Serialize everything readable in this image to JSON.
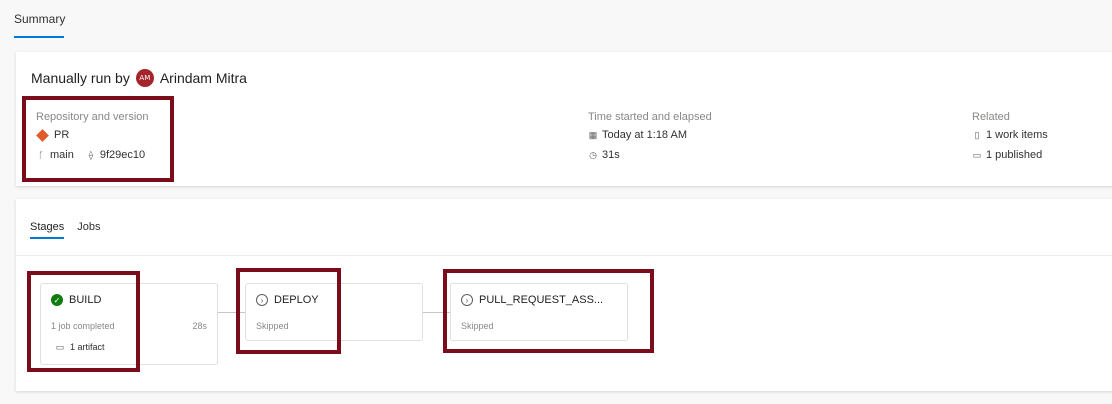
{
  "summary_tab": "Summary",
  "run": {
    "run_by_label": "Manually run by",
    "avatar_initials": "AM",
    "user_name": "Arindam Mitra"
  },
  "repository": {
    "label": "Repository and version",
    "repo_name": "PR",
    "branch": "main",
    "commit": "9f29ec10"
  },
  "time": {
    "label": "Time started and elapsed",
    "started": "Today at 1:18 AM",
    "elapsed": "31s"
  },
  "related": {
    "label": "Related",
    "work_items": "1 work items",
    "published": "1 published"
  },
  "stage_tabs": [
    "Stages",
    "Jobs"
  ],
  "stages": [
    {
      "name": "BUILD",
      "status": "1 job completed",
      "duration": "28s",
      "artifact": "1 artifact"
    },
    {
      "name": "DEPLOY",
      "status": "Skipped"
    },
    {
      "name": "PULL_REQUEST_ASS...",
      "status": "Skipped"
    }
  ],
  "colors": {
    "accent": "#0078d4",
    "success": "#107c10",
    "highlight": "#7a0c1c",
    "avatar": "#a4262c"
  }
}
